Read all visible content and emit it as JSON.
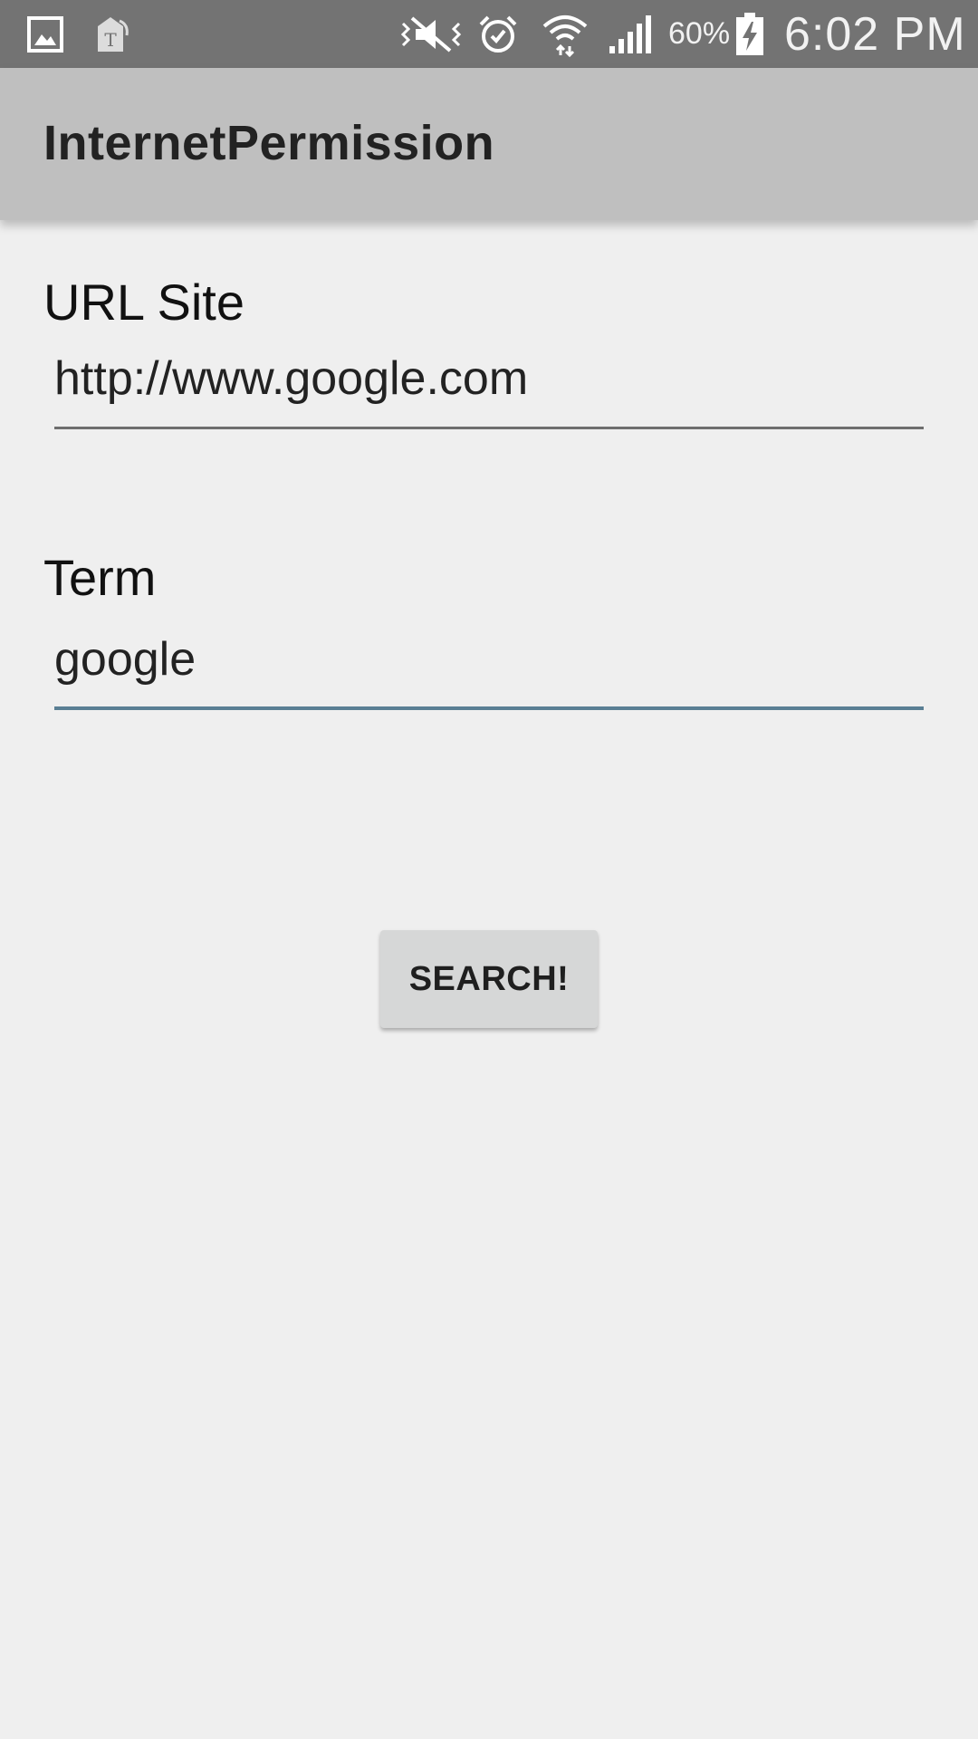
{
  "status_bar": {
    "icons": {
      "left": [
        "gallery-icon",
        "t-mobile-icon"
      ],
      "right": [
        "vibrate-mute-icon",
        "alarm-icon",
        "wifi-icon",
        "signal-icon",
        "battery-charging-icon"
      ]
    },
    "battery_percent": "60%",
    "time": "6:02 PM",
    "background": "#737373"
  },
  "app_bar": {
    "title": "InternetPermission",
    "background": "#bfbfbf"
  },
  "form": {
    "url_field": {
      "label": "URL Site",
      "value": "http://www.google.com"
    },
    "term_field": {
      "label": "Term",
      "value": "google",
      "focused": true
    },
    "search_button": {
      "label": "SEARCH!"
    }
  },
  "colors": {
    "page_background": "#efefef",
    "focus_underline": "#5a7f94",
    "button_background": "#d6d7d7"
  }
}
